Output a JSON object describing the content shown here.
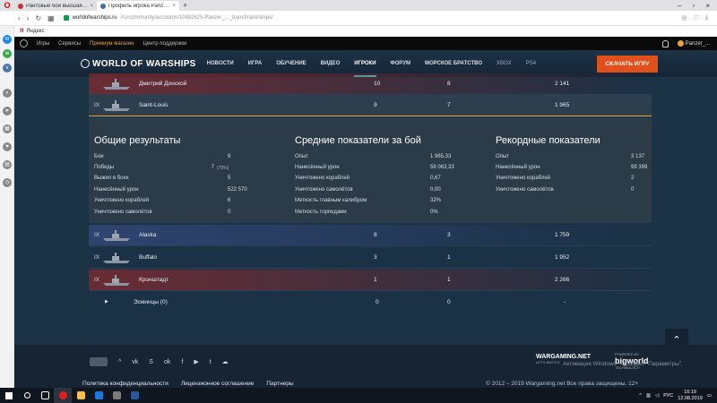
{
  "browser": {
    "tabs": [
      {
        "title": "Рантовые бои высшая ли...",
        "active": false
      },
      {
        "title": "Профиль игрока Panzer_...",
        "active": true
      }
    ],
    "url_host": "worldofwarships.ru",
    "url_path": "/ru/community/accounts/10482625-Panzer_..._transf/rank/ships/",
    "bookmark": "Яндекс"
  },
  "sitebar": {
    "games": "Игры",
    "services": "Сервисы",
    "premium": "Премиум магазин",
    "support": "Центр поддержки",
    "user": "Panzer_..."
  },
  "header": {
    "logo": "WORLD OF WARSHIPS",
    "nav": [
      "НОВОСТИ",
      "ИГРА",
      "ОБУЧЕНИЕ",
      "ВИДЕО",
      "ИГРОКИ",
      "ФОРУМ",
      "МОРСКОЕ БРАТСТВО"
    ],
    "active_nav": "ИГРОКИ",
    "platforms": [
      "XBOX",
      "PS4"
    ],
    "play_button": "СКАЧАТЬ ИГРУ"
  },
  "ships": [
    {
      "tier": "",
      "name": "Дмитрий Донской",
      "battles": "10",
      "wins": "8",
      "xp": "2 141",
      "nation": "ru",
      "selected": false
    },
    {
      "tier": "IX",
      "name": "Saint-Louis",
      "battles": "9",
      "wins": "7",
      "xp": "1 965",
      "nation": "fr",
      "selected": true
    },
    {
      "tier": "IX",
      "name": "Alaska",
      "battles": "8",
      "wins": "3",
      "xp": "1 759",
      "nation": "us",
      "selected": false
    },
    {
      "tier": "IX",
      "name": "Buffalo",
      "battles": "3",
      "wins": "1",
      "xp": "1 952",
      "nation": "us",
      "selected": false
    },
    {
      "tier": "IX",
      "name": "Кронштадт",
      "battles": "1",
      "wins": "1",
      "xp": "2 266",
      "nation": "ru",
      "selected": false
    }
  ],
  "stats": {
    "overall": {
      "title": "Общие результаты",
      "rows": [
        {
          "label": "Бои",
          "value": "9",
          "extra": ""
        },
        {
          "label": "Победы",
          "value": "7",
          "extra": "(78%)"
        },
        {
          "label": "Выжил в боях",
          "value": "5",
          "extra": ""
        },
        {
          "label": "Нанесённый урон",
          "value": "522 570",
          "extra": ""
        },
        {
          "label": "Уничтожено кораблей",
          "value": "6",
          "extra": ""
        },
        {
          "label": "Уничтожено самолётов",
          "value": "0",
          "extra": ""
        }
      ]
    },
    "average": {
      "title": "Средние показатели за бой",
      "rows": [
        {
          "label": "Опыт",
          "value": "1 965,33"
        },
        {
          "label": "Нанесённый урон",
          "value": "58 063,33"
        },
        {
          "label": "Уничтожено кораблей",
          "value": "0,67"
        },
        {
          "label": "Уничтожено самолётов",
          "value": "0,00"
        },
        {
          "label": "Меткость главным калибром",
          "value": "32%"
        },
        {
          "label": "Меткость торпедами",
          "value": "0%"
        }
      ]
    },
    "records": {
      "title": "Рекордные показатели",
      "rows": [
        {
          "label": "Опыт",
          "value": "3 137"
        },
        {
          "label": "Нанесённый урон",
          "value": "99 399"
        },
        {
          "label": "Уничтожено кораблей",
          "value": "2"
        },
        {
          "label": "Уничтожено самолётов",
          "value": "0"
        }
      ]
    }
  },
  "destroyers": {
    "label": "Эсминцы (0)",
    "battles": "0",
    "wins": "0",
    "xp": "-"
  },
  "footer": {
    "links": [
      "Политика конфиденциальности",
      "Лицензионное соглашение",
      "Партнеры"
    ],
    "copyright": "© 2012 – 2019 Wargaming.net Все права защищены. 12+",
    "wargaming": "WARGAMING.NET",
    "wargaming_sub": "LET'S BATTLE",
    "bigworld_prefix": "POWERED BY",
    "bigworld": "bigworld",
    "bigworld_sub": "TECHNOLOGY",
    "activate": "Активация Windows — раздел \"Параметры\"."
  },
  "taskbar": {
    "lang": "РУС",
    "time": "16:19",
    "date": "12.08.2019"
  }
}
